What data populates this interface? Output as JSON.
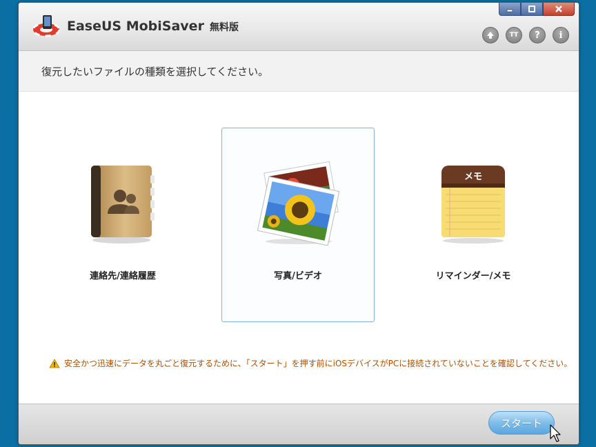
{
  "app": {
    "title": "EaseUS MobiSaver",
    "edition": "無料版"
  },
  "window_controls": {
    "minimize_icon": "minimize-icon",
    "maximize_icon": "maximize-icon",
    "close_icon": "close-icon"
  },
  "toolbar": {
    "icons": [
      "upgrade-icon",
      "font-size-icon",
      "help-icon",
      "info-icon"
    ],
    "font_size_glyph": "TT",
    "help_glyph": "?",
    "info_glyph": "i"
  },
  "instruction": "復元したいファイルの種類を選択してください。",
  "file_types": [
    {
      "label": "連絡先/連絡履歴",
      "icon": "contacts-book-icon",
      "selected": false
    },
    {
      "label": "写真/ビデオ",
      "icon": "photos-icon",
      "selected": true
    },
    {
      "label": "リマインダー/メモ",
      "icon": "notepad-icon",
      "selected": false
    }
  ],
  "notepad_header": "メモ",
  "warning": "安全かつ迅速にデータを丸ごと復元するために、「スタート」を押す前にiOSデバイスがPCに接続されていないことを確認してください。",
  "footer": {
    "start_label": "スタート"
  },
  "colors": {
    "desktop": "#0c6fa3",
    "accent": "#5ba6df",
    "warning_text": "#b04f00",
    "selected_border": "#8ab3dc"
  }
}
